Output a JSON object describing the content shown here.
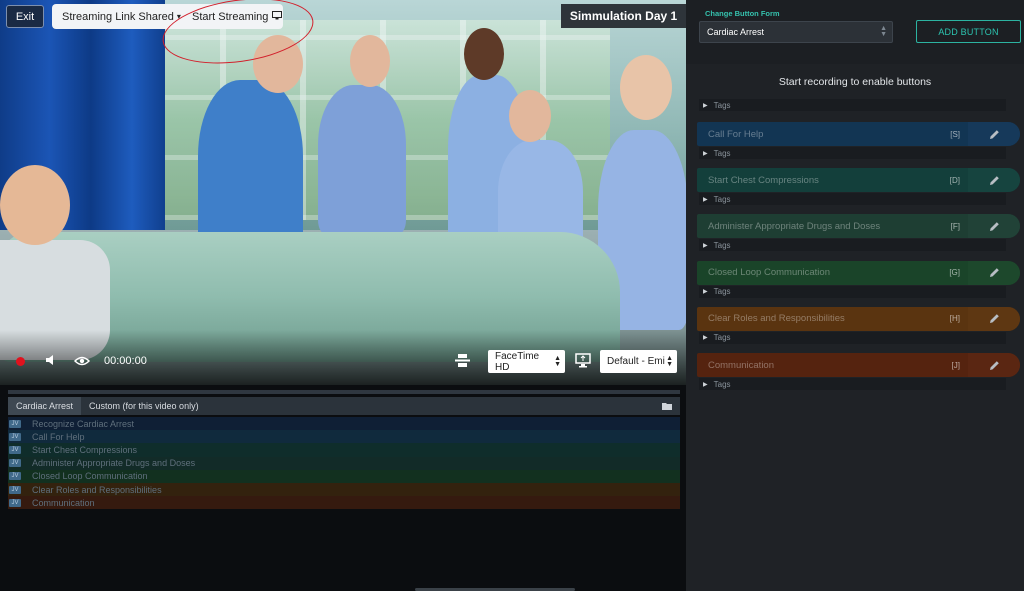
{
  "top_bar": {
    "exit_label": "Exit",
    "streaming_shared_label": "Streaming Link Shared",
    "start_streaming_label": "Start Streaming",
    "session_title": "Simmulation Day 1"
  },
  "player": {
    "timecode": "00:00:00",
    "camera_select": "FaceTime HD",
    "audio_select": "Default - Emi"
  },
  "timeline": {
    "tabs": [
      {
        "label": "Cardiac Arrest",
        "active": true
      },
      {
        "label": "Custom (for this video only)",
        "active": false
      }
    ],
    "rows": [
      {
        "tag": "JV",
        "label": "Recognize Cardiac Arrest",
        "color": "#0f1f35"
      },
      {
        "tag": "JV",
        "label": "Call For Help",
        "color": "#102a3d"
      },
      {
        "tag": "JV",
        "label": "Start Chest Compressions",
        "color": "#0f2d2b"
      },
      {
        "tag": "JV",
        "label": "Administer Appropriate Drugs and Doses",
        "color": "#122b28"
      },
      {
        "tag": "JV",
        "label": "Closed Loop Communication",
        "color": "#12301f"
      },
      {
        "tag": "JV",
        "label": "Clear Roles and Responsibilities",
        "color": "#33220e"
      },
      {
        "tag": "JV",
        "label": "Communication",
        "color": "#351a0f"
      }
    ]
  },
  "sidebar": {
    "form_label": "Change Button Form",
    "form_value": "Cardiac Arrest",
    "add_button_label": "ADD BUTTON",
    "recording_message": "Start recording to enable buttons",
    "tags_label": "Tags",
    "buttons": [
      {
        "label": "Call For Help",
        "key": "[S]",
        "color": "#123553",
        "edit_color": "#16395a"
      },
      {
        "label": "Start Chest Compressions",
        "key": "[D]",
        "color": "#133f3b",
        "edit_color": "#16443f"
      },
      {
        "label": "Administer Appropriate Drugs and Doses",
        "key": "[F]",
        "color": "#1e3e33",
        "edit_color": "#214237"
      },
      {
        "label": "Closed Loop Communication",
        "key": "[G]",
        "color": "#1a4429",
        "edit_color": "#1d482c"
      },
      {
        "label": "Clear Roles and Responsibilities",
        "key": "[H]",
        "color": "#5a3410",
        "edit_color": "#5e3712"
      },
      {
        "label": "Communication",
        "key": "[J]",
        "color": "#55230f",
        "edit_color": "#5a2612"
      }
    ]
  }
}
